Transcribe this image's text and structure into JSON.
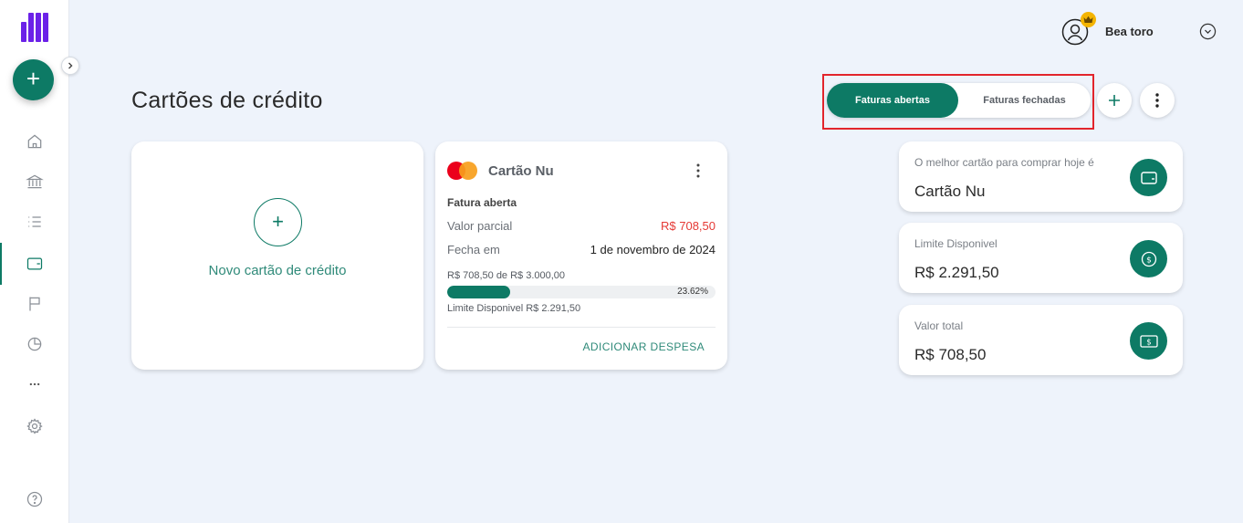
{
  "sidebar": {
    "items": [
      {
        "name": "home",
        "icon": "home-icon"
      },
      {
        "name": "accounts",
        "icon": "bank-icon"
      },
      {
        "name": "transactions",
        "icon": "list-icon"
      },
      {
        "name": "credit-cards",
        "icon": "wallet-icon",
        "active": true
      },
      {
        "name": "goals",
        "icon": "flag-icon"
      },
      {
        "name": "reports",
        "icon": "pie-chart-icon"
      },
      {
        "name": "more",
        "icon": "more-icon"
      },
      {
        "name": "settings",
        "icon": "gear-icon"
      },
      {
        "name": "help",
        "icon": "help-icon"
      }
    ]
  },
  "header": {
    "user_name": "Bea toro"
  },
  "page": {
    "title": "Cartões de crédito"
  },
  "toggle": {
    "open_label": "Faturas abertas",
    "closed_label": "Faturas fechadas",
    "selected": "open"
  },
  "new_card": {
    "label": "Novo cartão de crédito"
  },
  "credit_card": {
    "name": "Cartão Nu",
    "section": "Fatura aberta",
    "partial_label": "Valor parcial",
    "partial_value": "R$ 708,50",
    "closes_label": "Fecha em",
    "closes_value": "1 de novembro de 2024",
    "usage_text": "R$ 708,50 de R$ 3.000,00",
    "usage_percent": 23.62,
    "usage_percent_label": "23.62%",
    "available_text": "Limite Disponivel R$ 2.291,50",
    "action_label": "ADICIONAR DESPESA"
  },
  "summary": [
    {
      "label": "O melhor cartão para comprar hoje é",
      "value": "Cartão Nu",
      "icon": "wallet-icon"
    },
    {
      "label": "Limite Disponivel",
      "value": "R$ 2.291,50",
      "icon": "coin-icon"
    },
    {
      "label": "Valor total",
      "value": "R$ 708,50",
      "icon": "banknote-icon"
    }
  ],
  "colors": {
    "accent": "#0d7a65",
    "brand": "#6b21e8",
    "negative": "#e53935",
    "highlight": "#e2252c",
    "background": "#eef3fb"
  }
}
